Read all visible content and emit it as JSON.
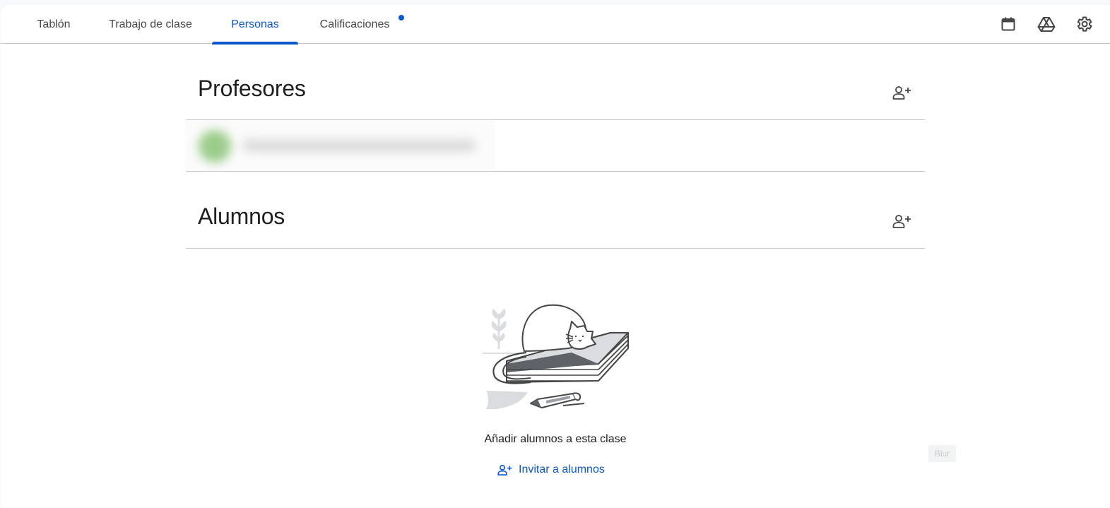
{
  "tabs": [
    {
      "label": "Tablón",
      "active": false
    },
    {
      "label": "Trabajo de clase",
      "active": false
    },
    {
      "label": "Personas",
      "active": true
    },
    {
      "label": "Calificaciones",
      "active": false,
      "notification_dot": true
    }
  ],
  "toolbar_icons": [
    "calendar-icon",
    "drive-icon",
    "gear-icon"
  ],
  "teachers": {
    "title": "Profesores",
    "add_icon": "add-person-icon",
    "rows": [
      {
        "name": "",
        "redacted": true
      }
    ]
  },
  "students": {
    "title": "Alumnos",
    "add_icon": "add-person-icon",
    "empty_state": {
      "illustration": "cat-on-books-illustration",
      "message": "Añadir alumnos a esta clase",
      "invite_label": "Invitar a alumnos"
    }
  },
  "overlay_label": "Blur",
  "colors": {
    "accent": "#0b57d0",
    "divider": "#c4c7c5",
    "text": "#1f1f1f",
    "muted": "#444746"
  }
}
